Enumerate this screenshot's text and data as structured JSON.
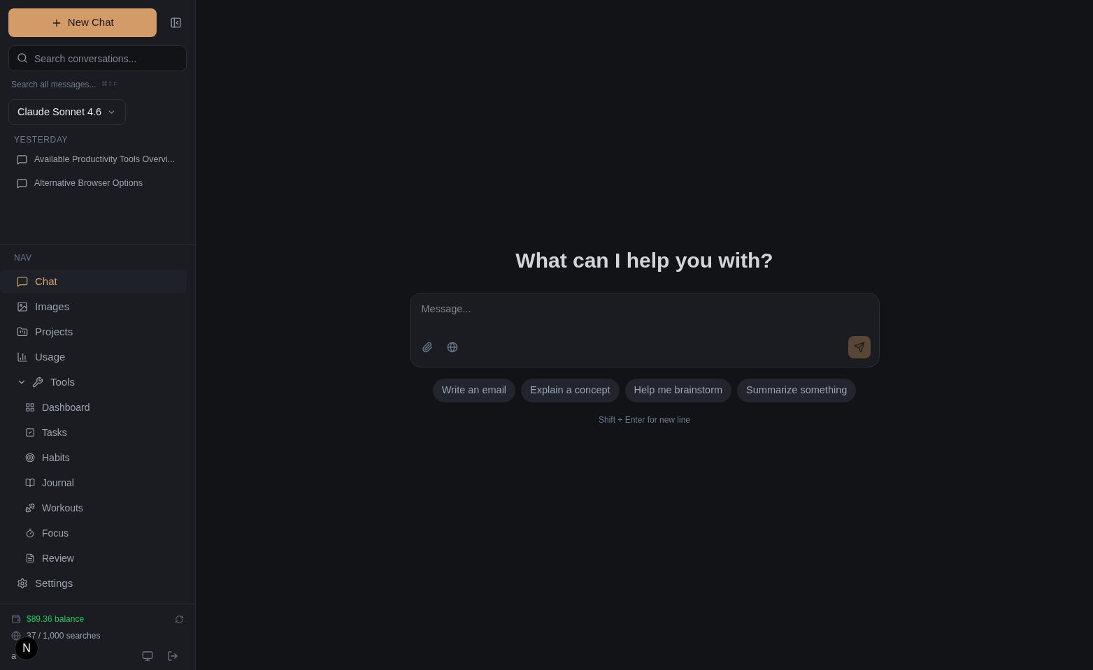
{
  "sidebar": {
    "new_chat": "New Chat",
    "search": {
      "placeholder": "Search conversations..."
    },
    "search_all": "Search all messages...",
    "search_all_shortcut": "⌘⇧F",
    "model": "Claude Sonnet 4.6",
    "history": {
      "heading": "YESTERDAY",
      "items": [
        {
          "title": "Available Productivity Tools Overvi..."
        },
        {
          "title": "Alternative Browser Options"
        }
      ]
    },
    "nav": {
      "heading": "NAV",
      "items": [
        {
          "label": "Chat",
          "kind": "chat",
          "selected": true
        },
        {
          "label": "Images",
          "kind": "image",
          "selected": false
        },
        {
          "label": "Projects",
          "kind": "folder",
          "selected": false
        },
        {
          "label": "Usage",
          "kind": "chart",
          "selected": false
        },
        {
          "label": "Tools",
          "kind": "wrench",
          "selected": false,
          "expanded": true,
          "children": [
            {
              "label": "Dashboard",
              "kind": "grid",
              "selected": false
            },
            {
              "label": "Tasks",
              "kind": "check",
              "selected": false
            },
            {
              "label": "Habits",
              "kind": "target",
              "selected": false
            },
            {
              "label": "Journal",
              "kind": "book",
              "selected": false
            },
            {
              "label": "Workouts",
              "kind": "dumbbell",
              "selected": false
            },
            {
              "label": "Focus",
              "kind": "timer",
              "selected": false
            },
            {
              "label": "Review",
              "kind": "file",
              "selected": false
            }
          ]
        },
        {
          "label": "Settings",
          "kind": "gear",
          "selected": false
        }
      ]
    },
    "footer": {
      "balance": "$89.36 balance",
      "searches": "37 / 1,000 searches",
      "user": "a",
      "badge": "N"
    }
  },
  "main": {
    "heading": "What can I help you with?",
    "composer": {
      "placeholder": "Message..."
    },
    "suggestions": [
      "Write an email",
      "Explain a concept",
      "Help me brainstorm",
      "Summarize something"
    ],
    "hint": "Shift + Enter for new line"
  }
}
